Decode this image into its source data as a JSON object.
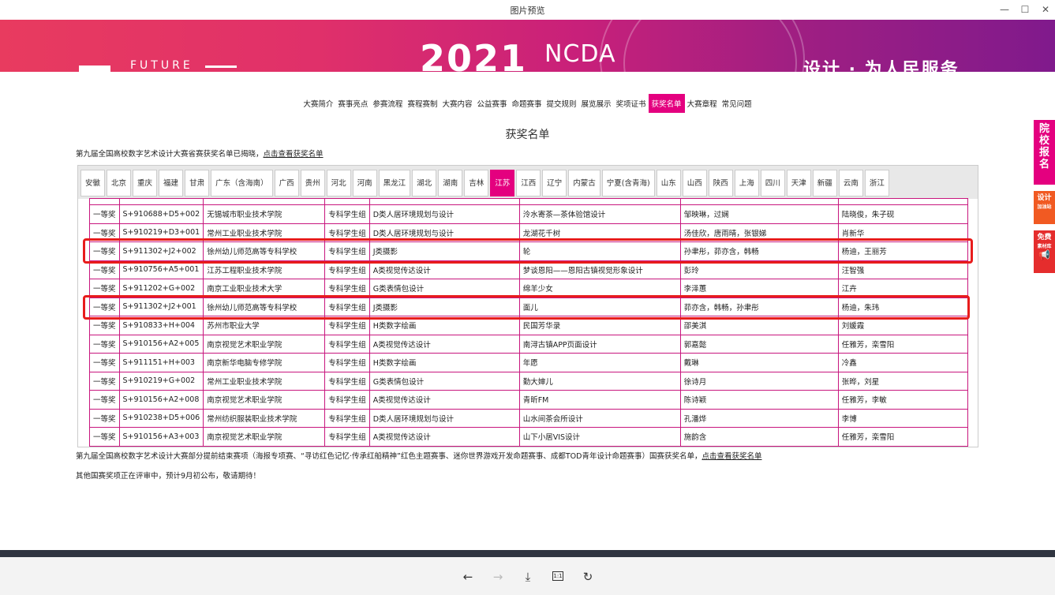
{
  "window": {
    "title": "图片预览",
    "minimize": "—",
    "maximize": "☐",
    "close": "✕"
  },
  "banner": {
    "future": "FUTURE",
    "year": "2021",
    "ncda": "NCDA",
    "slogan": "设计 · 为人民服务"
  },
  "nav": {
    "items": [
      "大赛简介",
      "赛事亮点",
      "参赛流程",
      "赛程赛制",
      "大赛内容",
      "公益赛事",
      "命题赛事",
      "提交规则",
      "展览展示",
      "奖项证书",
      "获奖名单",
      "大赛章程",
      "常见问题"
    ],
    "active": "获奖名单"
  },
  "page_heading": "获奖名单",
  "notice1": {
    "text": "第九届全国高校数字艺术设计大赛省赛获奖名单已揭晓，",
    "link": "点击查看获奖名单"
  },
  "province_tabs": [
    "安徽",
    "北京",
    "重庆",
    "福建",
    "甘肃",
    "广东（含海南）",
    "广西",
    "贵州",
    "河北",
    "河南",
    "黑龙江",
    "湖北",
    "湖南",
    "吉林",
    "江苏",
    "江西",
    "辽宁",
    "内蒙古",
    "宁夏(含青海)",
    "山东",
    "山西",
    "陕西",
    "上海",
    "四川",
    "天津",
    "新疆",
    "云南",
    "浙江"
  ],
  "active_tab": "江苏",
  "rows": [
    [
      "一等奖",
      "S+910688+D5+002",
      "无锡城市职业技术学院",
      "专科学生组",
      "D类人居环境规划与设计",
      "泠水寄茶—茶体验馆设计",
      "邹映琳，过娴",
      "陆晓俊，朱子砚"
    ],
    [
      "一等奖",
      "S+910219+D3+001",
      "常州工业职业技术学院",
      "专科学生组",
      "D类人居环境规划与设计",
      "龙湖花千树",
      "汤佳欣，唐雨晴，张银娣",
      "肖新华"
    ],
    [
      "一等奖",
      "S+911302+J2+002",
      "徐州幼儿师范高等专科学校",
      "专科学生组",
      "J类摄影",
      "轮",
      "孙聿彤，茆亦含，韩畅",
      "杨迪，王丽芳"
    ],
    [
      "一等奖",
      "S+910756+A5+001",
      "江苏工程职业技术学院",
      "专科学生组",
      "A类视觉传达设计",
      "梦谈恩阳——恩阳古镇视觉形象设计",
      "彭玲",
      "汪智强"
    ],
    [
      "一等奖",
      "S+911202+G+002",
      "南京工业职业技术大学",
      "专科学生组",
      "G类表情包设计",
      "绵羊少女",
      "李泽蕙",
      "江卉"
    ],
    [
      "一等奖",
      "S+911302+J2+001",
      "徐州幼儿师范高等专科学校",
      "专科学生组",
      "J类摄影",
      "面儿",
      "茆亦含，韩畅，孙聿彤",
      "杨迪，朱玮"
    ],
    [
      "一等奖",
      "S+910833+H+004",
      "苏州市职业大学",
      "专科学生组",
      "H类数字绘画",
      "民国芳华录",
      "邵美淇",
      "刘媛霞"
    ],
    [
      "一等奖",
      "S+910156+A2+005",
      "南京视觉艺术职业学院",
      "专科学生组",
      "A类视觉传达设计",
      "南浔古镇APP页面设计",
      "郭嘉懿",
      "任雅芳，栾雪阳"
    ],
    [
      "一等奖",
      "S+911151+H+003",
      "南京新华电脑专修学院",
      "专科学生组",
      "H类数字绘画",
      "年愿",
      "戴琳",
      "冷鑫"
    ],
    [
      "一等奖",
      "S+910219+G+002",
      "常州工业职业技术学院",
      "专科学生组",
      "G类表情包设计",
      "勤大婶儿",
      "徐诗月",
      "张晔，刘星"
    ],
    [
      "一等奖",
      "S+910156+A2+008",
      "南京视觉艺术职业学院",
      "专科学生组",
      "A类视觉传达设计",
      "青昕FM",
      "陈诗颖",
      "任雅芳，李敏"
    ],
    [
      "一等奖",
      "S+910238+D5+006",
      "常州纺织服装职业技术学院",
      "专科学生组",
      "D类人居环境规划与设计",
      "山水间茶会所设计",
      "孔潘烨",
      "李博"
    ],
    [
      "一等奖",
      "S+910156+A3+003",
      "南京视觉艺术职业学院",
      "专科学生组",
      "A类视觉传达设计",
      "山下小居VIS设计",
      "施韵含",
      "任雅芳，栾雪阳"
    ]
  ],
  "highlighted_rows": [
    2,
    5
  ],
  "notice2": {
    "text": "第九届全国高校数字艺术设计大赛部分提前结束赛项（海报专项赛、“寻访红色记忆·传承红船精神”红色主题赛事、迷你世界游戏开发命题赛事、成都TOD青年设计命题赛事）国赛获奖名单，",
    "link": "点击查看获奖名单"
  },
  "notice3": "其他国赛奖项正在评审中，预计9月初公布，敬请期待！",
  "side": {
    "apply": "院校报名",
    "design_top": "设计",
    "design_bottom": "加油站",
    "free_top": "免费",
    "free_bottom": "素材库"
  },
  "viewer": {
    "prev": "←",
    "next": "→",
    "download": "⤓",
    "actual_size": "1:1",
    "rotate": "↻"
  }
}
